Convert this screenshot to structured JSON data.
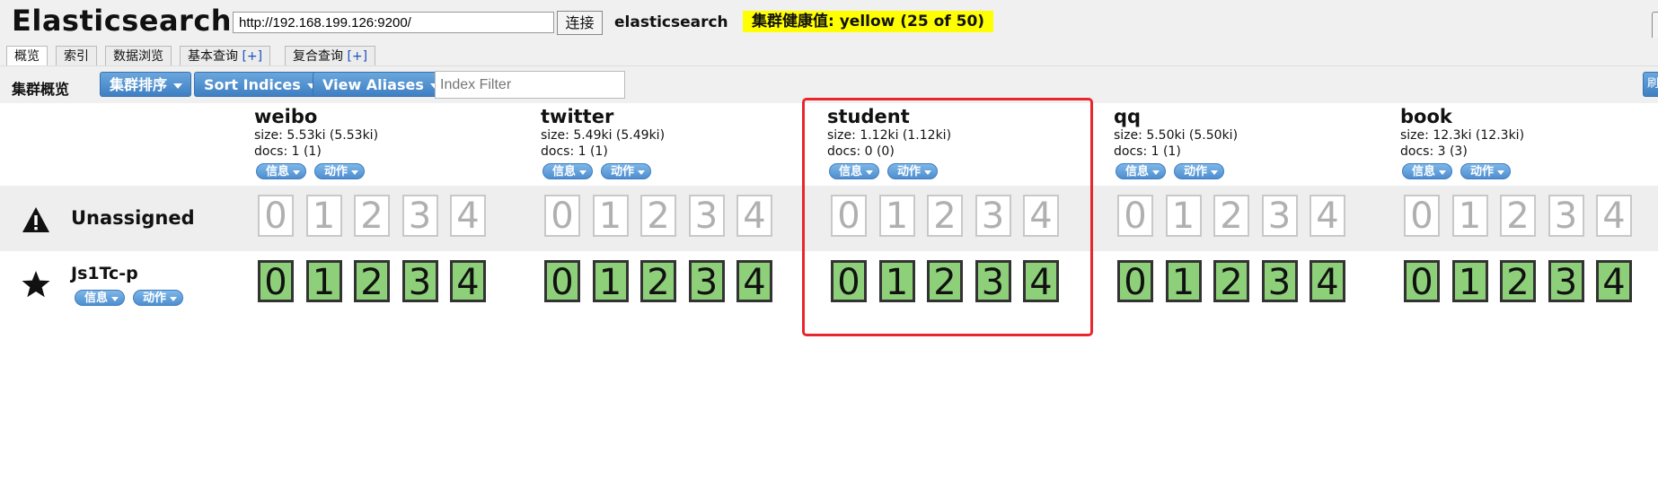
{
  "header": {
    "app_title": "Elasticsearch",
    "url_value": "http://192.168.199.126:9200/",
    "connect_label": "连接",
    "cluster_name": "elasticsearch",
    "health_text": "集群健康值: yellow (25 of 50)",
    "health_color": "#ffff00"
  },
  "tabs": [
    {
      "label": "概览",
      "active": true
    },
    {
      "label": "索引"
    },
    {
      "label": "数据浏览"
    },
    {
      "label": "基本查询",
      "plus": "[+]"
    },
    {
      "label": "复合查询",
      "plus": "[+]"
    }
  ],
  "toolbar": {
    "title": "集群概览",
    "sort_cluster_label": "集群排序",
    "sort_indices_label": "Sort Indices",
    "view_aliases_label": "View Aliases",
    "index_filter_placeholder": "Index Filter",
    "edge_button_label": "刷"
  },
  "index_actions": {
    "info": "信息",
    "action": "动作"
  },
  "indices": [
    {
      "name": "weibo",
      "size": "size: 5.53ki (5.53ki)",
      "docs": "docs: 1 (1)"
    },
    {
      "name": "twitter",
      "size": "size: 5.49ki (5.49ki)",
      "docs": "docs: 1 (1)"
    },
    {
      "name": "student",
      "size": "size: 1.12ki (1.12ki)",
      "docs": "docs: 0 (0)"
    },
    {
      "name": "qq",
      "size": "size: 5.50ki (5.50ki)",
      "docs": "docs: 1 (1)"
    },
    {
      "name": "book",
      "size": "size: 12.3ki (12.3ki)",
      "docs": "docs: 3 (3)"
    }
  ],
  "shard_numbers": [
    "0",
    "1",
    "2",
    "3",
    "4"
  ],
  "rows": {
    "unassigned": {
      "label": "Unassigned",
      "icon": "warning-icon",
      "status": "unassigned"
    },
    "node": {
      "label": "Js1Tc-p",
      "icon": "star-icon",
      "status": "started",
      "info": "信息",
      "action": "动作"
    }
  },
  "colors": {
    "started_shard": "#8ed07a",
    "highlight": "#e8262c",
    "button_blue": "#3f7fc2"
  }
}
